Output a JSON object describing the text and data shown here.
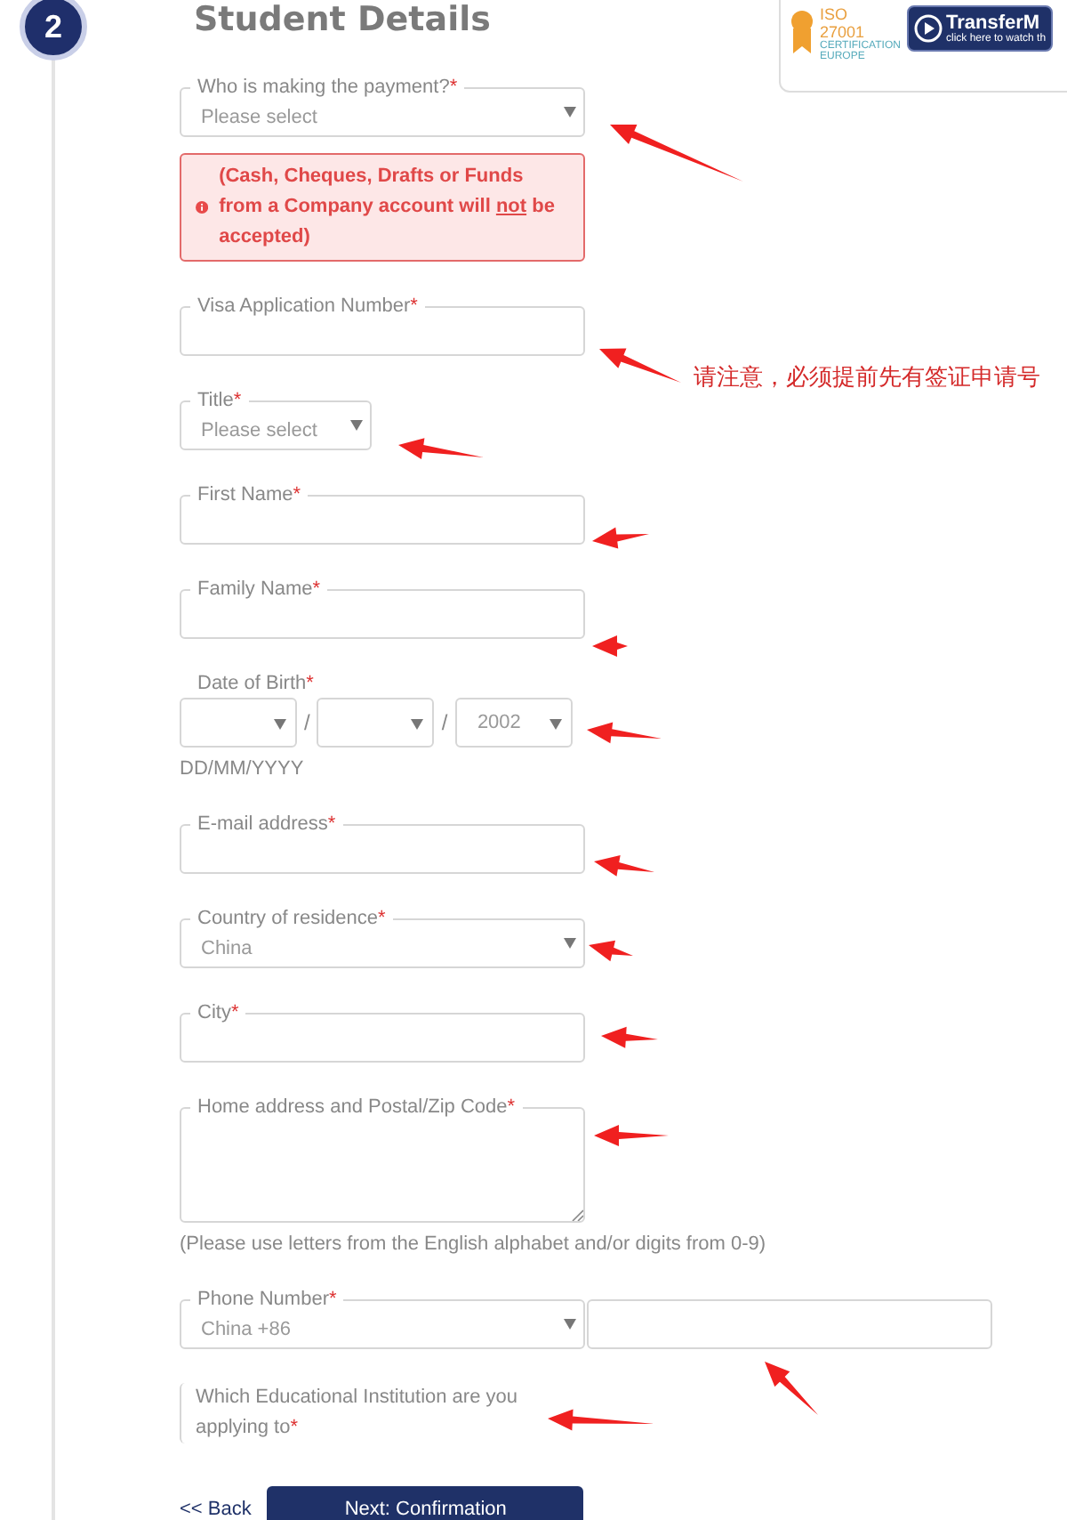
{
  "step": {
    "number": "2",
    "title": "Student Details"
  },
  "badges": {
    "iso_label": "ISO",
    "iso_number": "27001",
    "iso_caption": "CERTIFICATION EUROPE",
    "video_title": "TransferM",
    "video_caption": "click here to watch th"
  },
  "notice": {
    "before": "(Cash, Cheques, Drafts or Funds from a Company account will ",
    "underlined": "not",
    "after": " be accepted)"
  },
  "fields": [
    {
      "kind": "select",
      "label": "Who is making the payment?",
      "mark": "*",
      "value": "Please select"
    },
    {
      "kind": "notice"
    },
    {
      "kind": "text",
      "label": "Visa Application Number",
      "mark": "*"
    },
    {
      "kind": "short_select",
      "label": "Title",
      "mark": "*",
      "value": "Please select"
    },
    {
      "kind": "text",
      "label": "First Name",
      "mark": "*"
    },
    {
      "kind": "text",
      "label": "Family Name",
      "mark": "*"
    },
    {
      "kind": "date",
      "label": "Date of Birth",
      "mark": "*",
      "year": "2002",
      "separators": [
        "/",
        "/"
      ],
      "hint": "DD/MM/YYYY"
    },
    {
      "kind": "text",
      "label": "E-mail address",
      "mark": "*"
    },
    {
      "kind": "select",
      "label": "Country of residence",
      "mark": "*",
      "value": "China"
    },
    {
      "kind": "text",
      "label": "City",
      "mark": "*"
    },
    {
      "kind": "textarea",
      "label": "Home address and Postal/Zip Code",
      "mark": "*",
      "hint": "(Please use letters from the English alphabet and/or digits from 0-9)"
    },
    {
      "kind": "phone",
      "label": "Phone Number",
      "mark": "*",
      "value": "China +86"
    },
    {
      "kind": "open",
      "label": "Which Educational Institution are you applying to",
      "mark": "*"
    }
  ],
  "annotation": {
    "note": "请注意，必须提前先有签证申请号"
  },
  "actions": {
    "back": "<< Back",
    "next": "Next: Confirmation"
  }
}
